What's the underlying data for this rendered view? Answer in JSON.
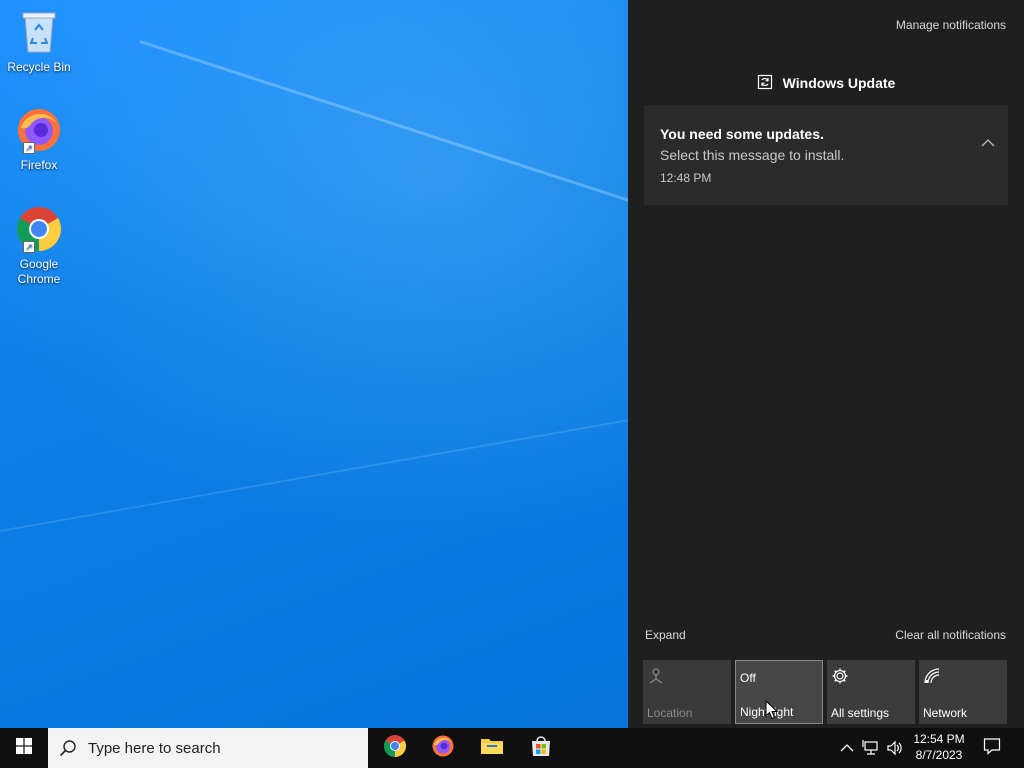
{
  "desktop": {
    "icons": [
      {
        "label": "Recycle Bin"
      },
      {
        "label": "Firefox"
      },
      {
        "label": "Google Chrome"
      }
    ]
  },
  "action_center": {
    "manage_notifications": "Manage notifications",
    "group": {
      "app_name": "Windows Update",
      "icon": "windows-update-icon"
    },
    "notification": {
      "title": "You need some updates.",
      "body": "Select this message to install.",
      "time": "12:48 PM"
    },
    "expand_label": "Expand",
    "clear_all_label": "Clear all notifications",
    "quick_actions": [
      {
        "label": "Location",
        "status": "",
        "icon": "location-icon",
        "state": "disabled"
      },
      {
        "label": "Night light",
        "status": "Off",
        "icon": "",
        "state": "hover"
      },
      {
        "label": "All settings",
        "status": "",
        "icon": "gear-icon",
        "state": "normal"
      },
      {
        "label": "Network",
        "status": "",
        "icon": "network-icon",
        "state": "normal"
      }
    ]
  },
  "taskbar": {
    "search_placeholder": "Type here to search",
    "pinned_apps": [
      "Google Chrome",
      "Firefox",
      "File Explorer",
      "Microsoft Store"
    ],
    "clock": {
      "time": "12:54 PM",
      "date": "8/7/2023"
    }
  },
  "colors": {
    "desktop_blue": "#0b7fe6",
    "action_center_bg": "#1f1f1f",
    "card_bg": "#2b2b2b",
    "tile_bg": "#3c3c3c",
    "taskbar_bg": "#101010"
  }
}
